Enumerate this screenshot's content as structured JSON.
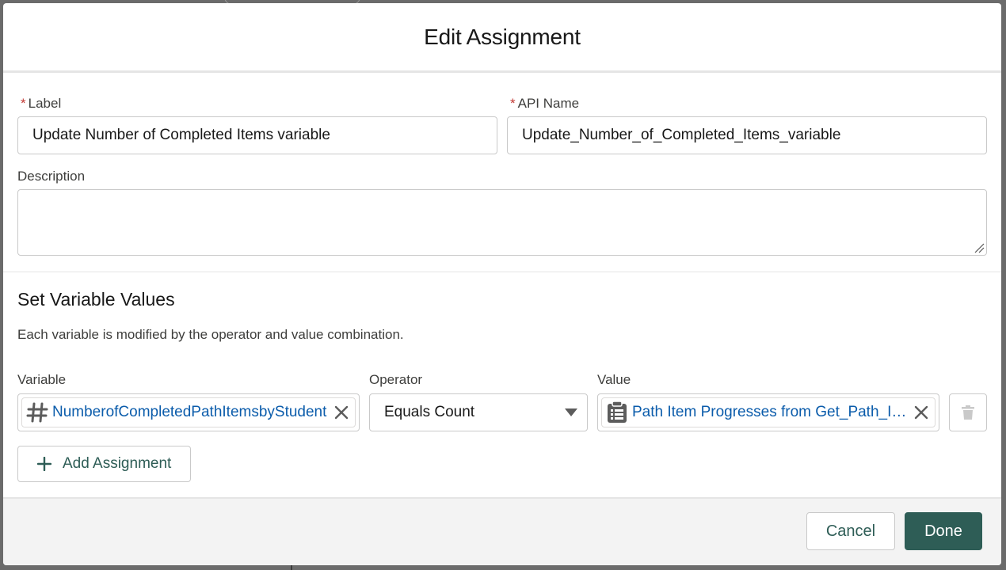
{
  "modal": {
    "title": "Edit Assignment"
  },
  "form": {
    "label": {
      "label": "Label",
      "value": "Update Number of Completed Items variable",
      "required": "*"
    },
    "api_name": {
      "label": "API Name",
      "value": "Update_Number_of_Completed_Items_variable",
      "required": "*"
    },
    "description": {
      "label": "Description",
      "value": ""
    }
  },
  "assignments": {
    "section_title": "Set Variable Values",
    "section_desc": "Each variable is modified by the operator and value combination.",
    "columns": {
      "variable": "Variable",
      "operator": "Operator",
      "value": "Value"
    },
    "rows": [
      {
        "variable": "NumberofCompletedPathItemsbyStudent",
        "variable_icon": "hash-icon",
        "operator": "Equals Count",
        "value": "Path Item Progresses from Get_Path_Item_Progresses",
        "value_icon": "record-collection-icon"
      }
    ],
    "add_label": "Add Assignment"
  },
  "footer": {
    "cancel_label": "Cancel",
    "done_label": "Done"
  },
  "colors": {
    "brand": "#2e5d56",
    "link": "#0b5cab",
    "required": "#c23934"
  }
}
